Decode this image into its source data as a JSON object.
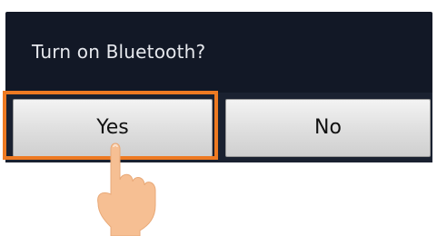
{
  "dialog": {
    "title": "Turn on Bluetooth?",
    "buttons": {
      "yes_label": "Yes",
      "no_label": "No"
    }
  },
  "highlight_color": "#ee7a22",
  "pointer_icon": "hand-pointer-icon"
}
